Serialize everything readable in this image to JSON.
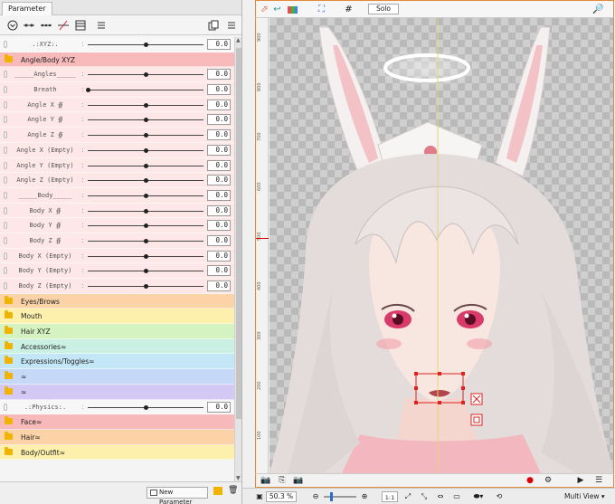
{
  "panel": {
    "tab_label": "Parameter",
    "new_parameter_label": "New Parameter"
  },
  "viewport": {
    "solo_label": "Solo"
  },
  "ruler_ticks": [
    "900",
    "800",
    "700",
    "600",
    "500",
    "400",
    "300",
    "200",
    "100"
  ],
  "status": {
    "zoom": "50.3 %",
    "one_to_one": "1:1",
    "multi_view": "Multi View"
  },
  "rows": [
    {
      "kind": "param",
      "name": ".:XYZ:.",
      "value": "0.0",
      "pos": 0.5,
      "white": true
    },
    {
      "kind": "group",
      "name": "Angle/Body XYZ",
      "color": "#f7b9b9"
    },
    {
      "kind": "param",
      "name": "_____Angles_____",
      "value": "0.0",
      "pos": 0.5
    },
    {
      "kind": "param",
      "name": "Breath",
      "value": "0.0",
      "pos": 0.0
    },
    {
      "kind": "param",
      "name": "Angle X ∯",
      "value": "0.0",
      "pos": 0.5
    },
    {
      "kind": "param",
      "name": "Angle Y ∯",
      "value": "0.0",
      "pos": 0.5
    },
    {
      "kind": "param",
      "name": "Angle Z ∯",
      "value": "0.0",
      "pos": 0.5
    },
    {
      "kind": "param",
      "name": "Angle X (Empty)",
      "value": "0.0",
      "pos": 0.5
    },
    {
      "kind": "param",
      "name": "Angle Y (Empty)",
      "value": "0.0",
      "pos": 0.5
    },
    {
      "kind": "param",
      "name": "Angle Z (Empty)",
      "value": "0.0",
      "pos": 0.5
    },
    {
      "kind": "param",
      "name": "_____Body_____",
      "value": "0.0",
      "pos": 0.5
    },
    {
      "kind": "param",
      "name": "Body X ∯",
      "value": "0.0",
      "pos": 0.5
    },
    {
      "kind": "param",
      "name": "Body Y ∯",
      "value": "0.0",
      "pos": 0.5
    },
    {
      "kind": "param",
      "name": "Body Z ∯",
      "value": "0.0",
      "pos": 0.5
    },
    {
      "kind": "param",
      "name": "Body X (Empty)",
      "value": "0.0",
      "pos": 0.5
    },
    {
      "kind": "param",
      "name": "Body Y (Empty)",
      "value": "0.0",
      "pos": 0.5
    },
    {
      "kind": "param",
      "name": "Body Z (Empty)",
      "value": "0.0",
      "pos": 0.5
    },
    {
      "kind": "group",
      "name": "Eyes/Brows",
      "color": "#fbd3a6"
    },
    {
      "kind": "group",
      "name": "Mouth",
      "color": "#fdf0ad"
    },
    {
      "kind": "group",
      "name": "Hair XYZ",
      "color": "#d4f3c0"
    },
    {
      "kind": "group",
      "name": "Accessories≈",
      "color": "#c9f0e2"
    },
    {
      "kind": "group",
      "name": "Expressions/Toggles≈",
      "color": "#c3e7f6"
    },
    {
      "kind": "group",
      "name": "≈",
      "color": "#c6d8f7"
    },
    {
      "kind": "group",
      "name": "≈",
      "color": "#d4c9f4"
    },
    {
      "kind": "param",
      "name": ".:Physics:.",
      "value": "0.0",
      "pos": 0.5,
      "white": true
    },
    {
      "kind": "group",
      "name": "Face≈",
      "color": "#f7b9b9"
    },
    {
      "kind": "group",
      "name": "Hair≈",
      "color": "#fbd3a6"
    },
    {
      "kind": "group",
      "name": "Body/Outfit≈",
      "color": "#fdf0ad"
    }
  ]
}
